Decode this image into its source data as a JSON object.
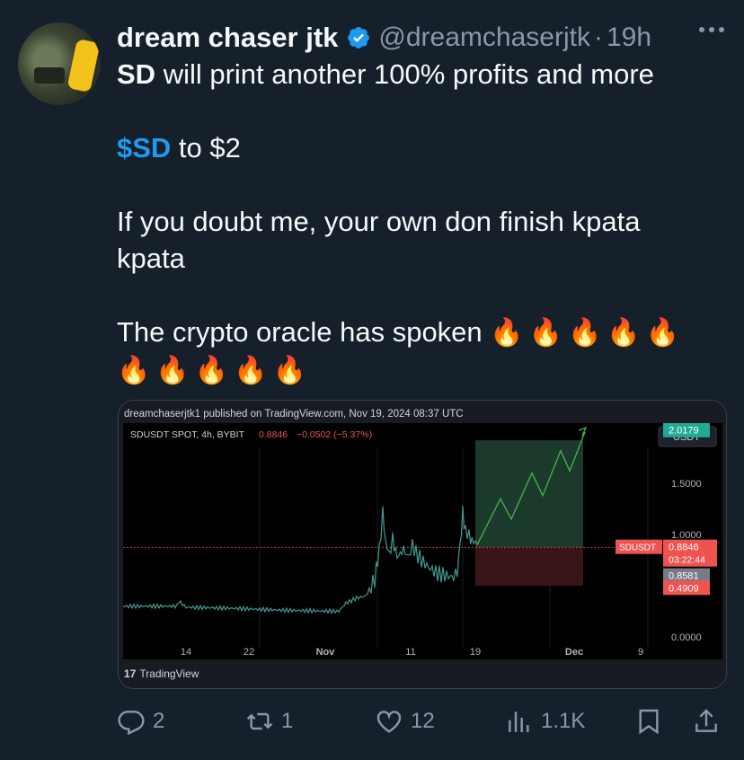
{
  "tweet": {
    "author_name": "dream chaser jtk",
    "handle": "@dreamchaserjtk",
    "separator": "·",
    "time": "19h",
    "lines": {
      "l1_bold": "SD",
      "l1_rest": " will print another 100% profits and more",
      "l2_cashtag": "$SD",
      "l2_rest": " to $2",
      "l3": "If you doubt me, your own don finish kpata",
      "l4": "kpata",
      "l5": "The crypto oracle has spoken "
    },
    "emoji": "🔥"
  },
  "chart_card": {
    "published_line": "dreamchaserjtk1 published on TradingView.com, Nov 19, 2024 08:37 UTC",
    "symbol_line": "SDUSDT SPOT, 4h, BYBIT",
    "last_price": "0.8846",
    "change": "−0.0502 (−5.37%)",
    "currency_button": "USDT",
    "footer": "TradingView",
    "footer_logo": "17"
  },
  "chart_data": {
    "type": "line",
    "xticks": [
      "14",
      "22",
      "Nov",
      "11",
      "19",
      "Dec",
      "9"
    ],
    "yticks": [
      "1.5000",
      "1.0000",
      "0.0000"
    ],
    "price_labels": {
      "target": "2.0179",
      "symbol": "SDUSDT",
      "last": "0.8846",
      "countdown": "03:22:44",
      "mid": "0.8581",
      "stop": "0.4909"
    },
    "ylim": [
      -0.3,
      2.4
    ],
    "colors": {
      "up": "#26a69a",
      "down": "#ef5350",
      "projection": "#4caf50",
      "target_zone": "#1b3a2b",
      "stop_zone": "#3a1518"
    }
  },
  "actions": {
    "replies": "2",
    "reposts": "1",
    "likes": "12",
    "views": "1.1K"
  }
}
